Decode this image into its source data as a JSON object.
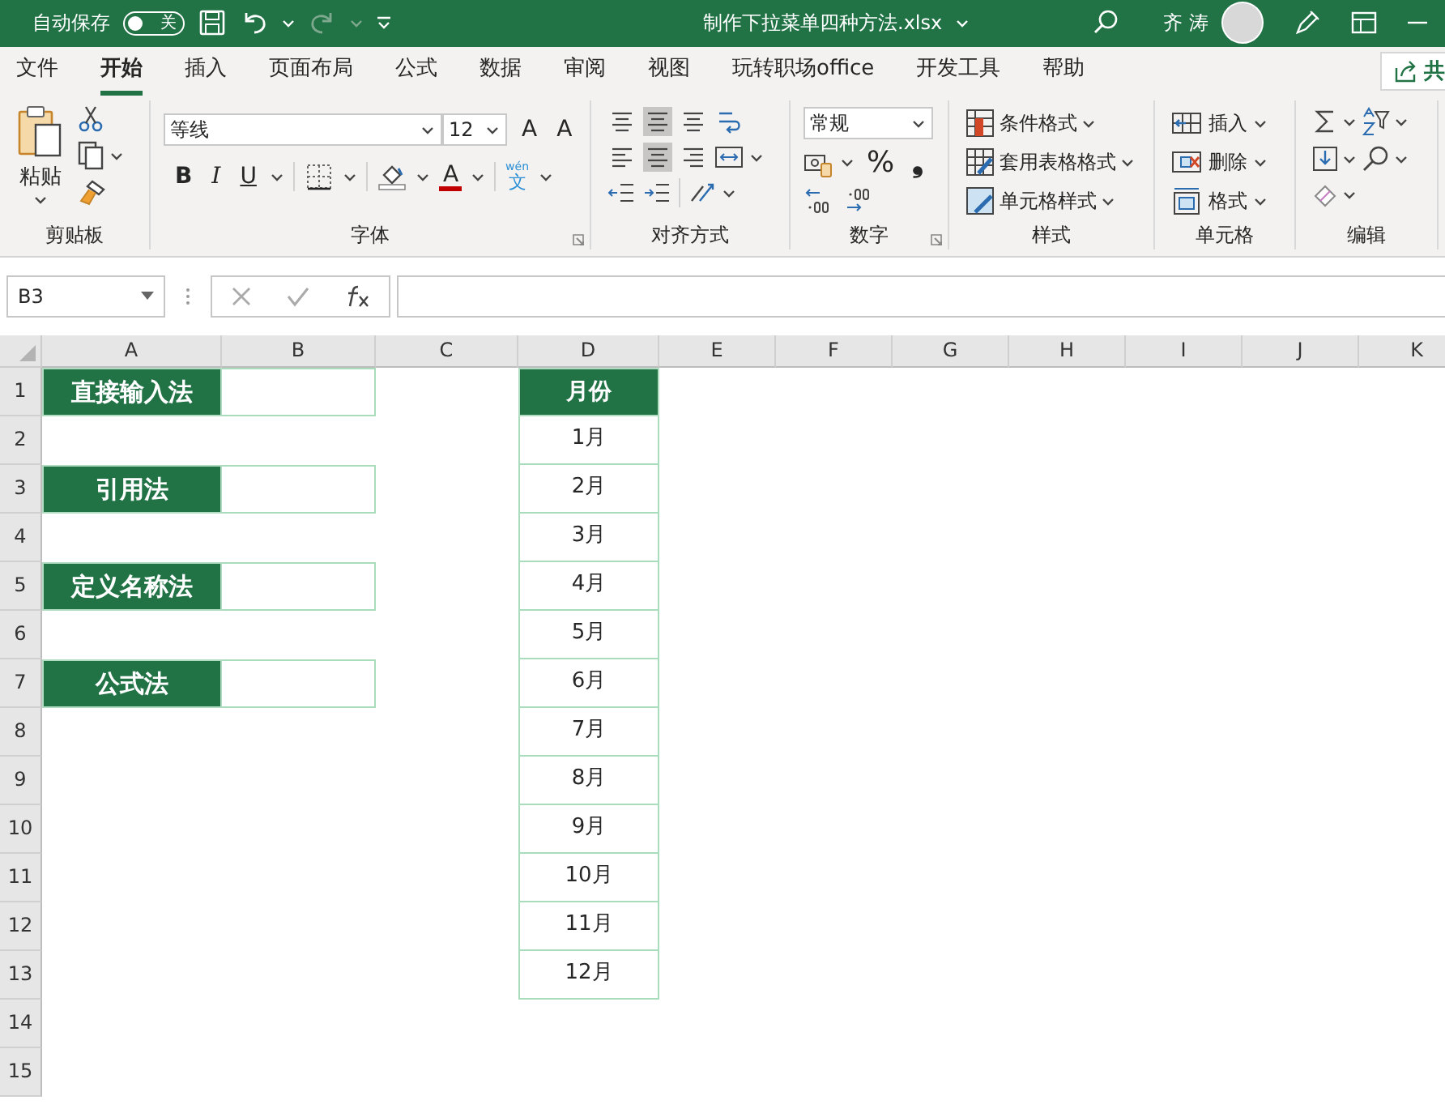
{
  "title_bar": {
    "autosave_label": "自动保存",
    "autosave": {
      "label": "关",
      "on": false
    },
    "filename": "制作下拉菜单四种方法.xlsx",
    "user": "齐 涛"
  },
  "ribbon_tabs": [
    {
      "label": "文件",
      "selected": false
    },
    {
      "label": "开始",
      "selected": true
    },
    {
      "label": "插入",
      "selected": false
    },
    {
      "label": "页面布局",
      "selected": false
    },
    {
      "label": "公式",
      "selected": false
    },
    {
      "label": "数据",
      "selected": false
    },
    {
      "label": "审阅",
      "selected": false
    },
    {
      "label": "视图",
      "selected": false
    },
    {
      "label": "玩转职场office",
      "selected": false
    },
    {
      "label": "开发工具",
      "selected": false
    },
    {
      "label": "帮助",
      "selected": false
    }
  ],
  "share_button": "共",
  "ribbon": {
    "clipboard": {
      "paste": "粘贴",
      "label": "剪贴板"
    },
    "font": {
      "font_name": "等线",
      "font_size": "12",
      "grow": "A",
      "shrink": "A",
      "bold": "B",
      "italic": "I",
      "underline": "U",
      "font_color": "A",
      "phonetic": "文",
      "phonetic_hint": "wén",
      "label": "字体"
    },
    "alignment": {
      "label": "对齐方式"
    },
    "number": {
      "format": "常规",
      "percent": "%",
      "comma": "❟",
      "label": "数字"
    },
    "styles": {
      "items": [
        "条件格式",
        "套用表格格式",
        "单元格样式"
      ],
      "label": "样式"
    },
    "cells": {
      "items": [
        "插入",
        "删除",
        "格式"
      ],
      "label": "单元格"
    },
    "editing": {
      "label": "编辑"
    }
  },
  "formula_bar": {
    "name_box": "B3"
  },
  "sheet": {
    "columns": [
      "A",
      "B",
      "C",
      "D",
      "E",
      "F",
      "G",
      "H",
      "I",
      "J",
      "K"
    ],
    "rows": [
      {
        "number": "1",
        "cells": [
          {
            "kind": "label",
            "text": "直接输入法"
          },
          {
            "kind": "input"
          },
          {
            "kind": "blank"
          },
          {
            "kind": "header",
            "text": "月份"
          }
        ]
      },
      {
        "number": "2",
        "cells": [
          {
            "kind": "blank"
          },
          {
            "kind": "blank"
          },
          {
            "kind": "blank"
          },
          {
            "kind": "item",
            "text": "1月"
          }
        ]
      },
      {
        "number": "3",
        "cells": [
          {
            "kind": "label",
            "text": "引用法"
          },
          {
            "kind": "input"
          },
          {
            "kind": "blank"
          },
          {
            "kind": "item",
            "text": "2月"
          }
        ]
      },
      {
        "number": "4",
        "cells": [
          {
            "kind": "blank"
          },
          {
            "kind": "blank"
          },
          {
            "kind": "blank"
          },
          {
            "kind": "item",
            "text": "3月"
          }
        ]
      },
      {
        "number": "5",
        "cells": [
          {
            "kind": "label",
            "text": "定义名称法"
          },
          {
            "kind": "input"
          },
          {
            "kind": "blank"
          },
          {
            "kind": "item",
            "text": "4月"
          }
        ]
      },
      {
        "number": "6",
        "cells": [
          {
            "kind": "blank"
          },
          {
            "kind": "blank"
          },
          {
            "kind": "blank"
          },
          {
            "kind": "item",
            "text": "5月"
          }
        ]
      },
      {
        "number": "7",
        "cells": [
          {
            "kind": "label",
            "text": "公式法"
          },
          {
            "kind": "input"
          },
          {
            "kind": "blank"
          },
          {
            "kind": "item",
            "text": "6月"
          }
        ]
      },
      {
        "number": "8",
        "cells": [
          {
            "kind": "blank"
          },
          {
            "kind": "blank"
          },
          {
            "kind": "blank"
          },
          {
            "kind": "item",
            "text": "7月"
          }
        ]
      },
      {
        "number": "9",
        "cells": [
          {
            "kind": "blank"
          },
          {
            "kind": "blank"
          },
          {
            "kind": "blank"
          },
          {
            "kind": "item",
            "text": "8月"
          }
        ]
      },
      {
        "number": "10",
        "cells": [
          {
            "kind": "blank"
          },
          {
            "kind": "blank"
          },
          {
            "kind": "blank"
          },
          {
            "kind": "item",
            "text": "9月"
          }
        ]
      },
      {
        "number": "11",
        "cells": [
          {
            "kind": "blank"
          },
          {
            "kind": "blank"
          },
          {
            "kind": "blank"
          },
          {
            "kind": "item",
            "text": "10月"
          }
        ]
      },
      {
        "number": "12",
        "cells": [
          {
            "kind": "blank"
          },
          {
            "kind": "blank"
          },
          {
            "kind": "blank"
          },
          {
            "kind": "item",
            "text": "11月"
          }
        ]
      },
      {
        "number": "13",
        "cells": [
          {
            "kind": "blank"
          },
          {
            "kind": "blank"
          },
          {
            "kind": "blank"
          },
          {
            "kind": "item",
            "text": "12月"
          }
        ]
      },
      {
        "number": "14",
        "cells": []
      },
      {
        "number": "15",
        "cells": []
      }
    ]
  }
}
